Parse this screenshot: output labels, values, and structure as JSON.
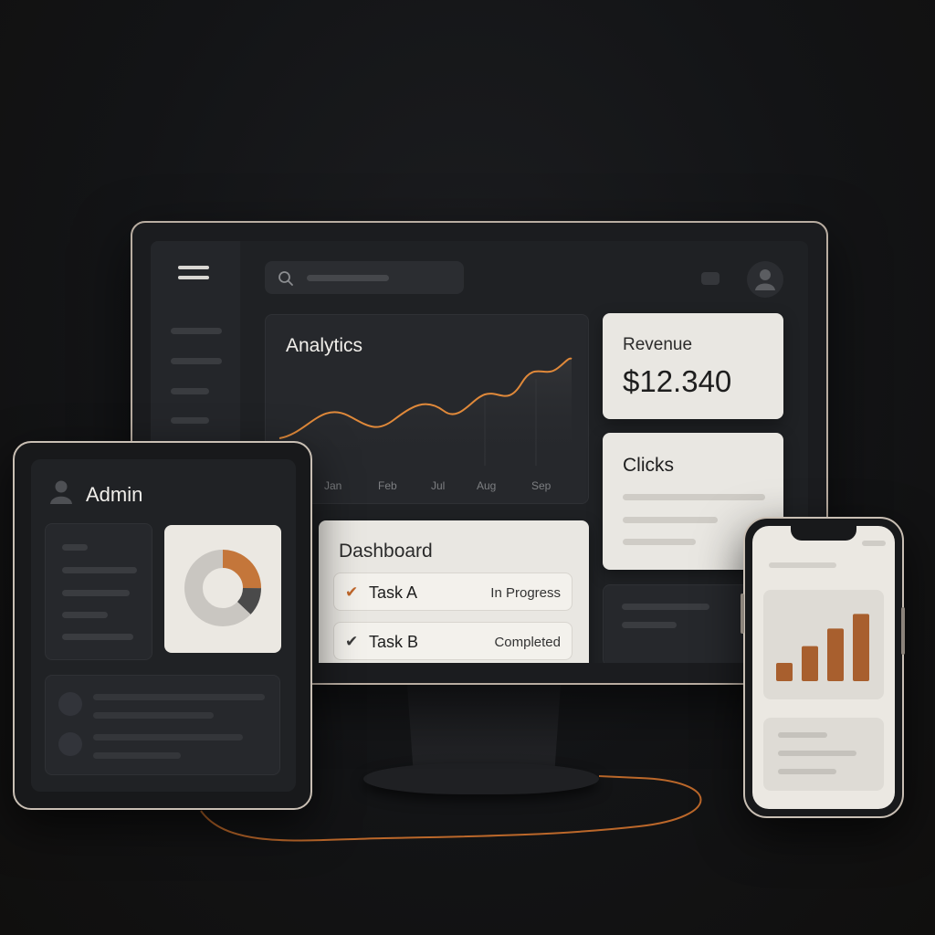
{
  "monitor": {
    "analytics": {
      "title": "Analytics",
      "months": [
        "Jan",
        "Feb",
        "Jul",
        "Aug",
        "Sep"
      ]
    },
    "revenue": {
      "label": "Revenue",
      "value": "$12.340"
    },
    "clicks": {
      "title": "Clicks"
    },
    "dashboard": {
      "title": "Dashboard",
      "tasks": [
        {
          "name": "Task A",
          "status": "In Progress",
          "check_color": "#c0672b"
        },
        {
          "name": "Task B",
          "status": "Completed",
          "check_color": "#3a3a3a"
        }
      ]
    }
  },
  "tablet": {
    "admin_label": "Admin",
    "donut": {
      "segments": [
        {
          "fraction": 0.25,
          "color": "#c4763a"
        },
        {
          "fraction": 0.12,
          "color": "#4a4a4a"
        },
        {
          "fraction": 0.63,
          "color": "#c9c6c1"
        }
      ]
    }
  },
  "phone": {
    "bars": [
      0.25,
      0.48,
      0.72,
      0.92
    ],
    "bar_color": "#a85f2e"
  },
  "colors": {
    "accent": "#e0893a",
    "background": "#131416",
    "card_light": "#e9e7e2",
    "card_dark": "#26282c"
  }
}
